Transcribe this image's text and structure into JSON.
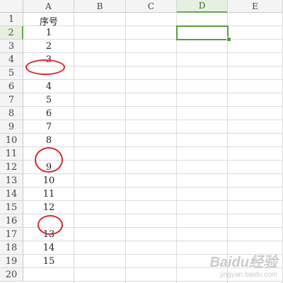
{
  "columns": [
    "A",
    "B",
    "C",
    "D",
    "E"
  ],
  "active_column": "D",
  "rows": [
    "1",
    "2",
    "3",
    "4",
    "5",
    "6",
    "7",
    "8",
    "9",
    "10",
    "11",
    "12",
    "13",
    "14",
    "15",
    "16",
    "17",
    "18",
    "19",
    "20"
  ],
  "active_row": "2",
  "column_a_values": [
    "序号",
    "1",
    "2",
    "3",
    "",
    "4",
    "5",
    "6",
    "7",
    "8",
    "",
    "9",
    "10",
    "11",
    "12",
    "",
    "13",
    "14",
    "15",
    ""
  ],
  "watermark": {
    "brand": "Baidu经验",
    "url": "jingyan.baidu.com"
  },
  "annotation_color": "#d9262b",
  "selection_color": "#5a9e3a"
}
